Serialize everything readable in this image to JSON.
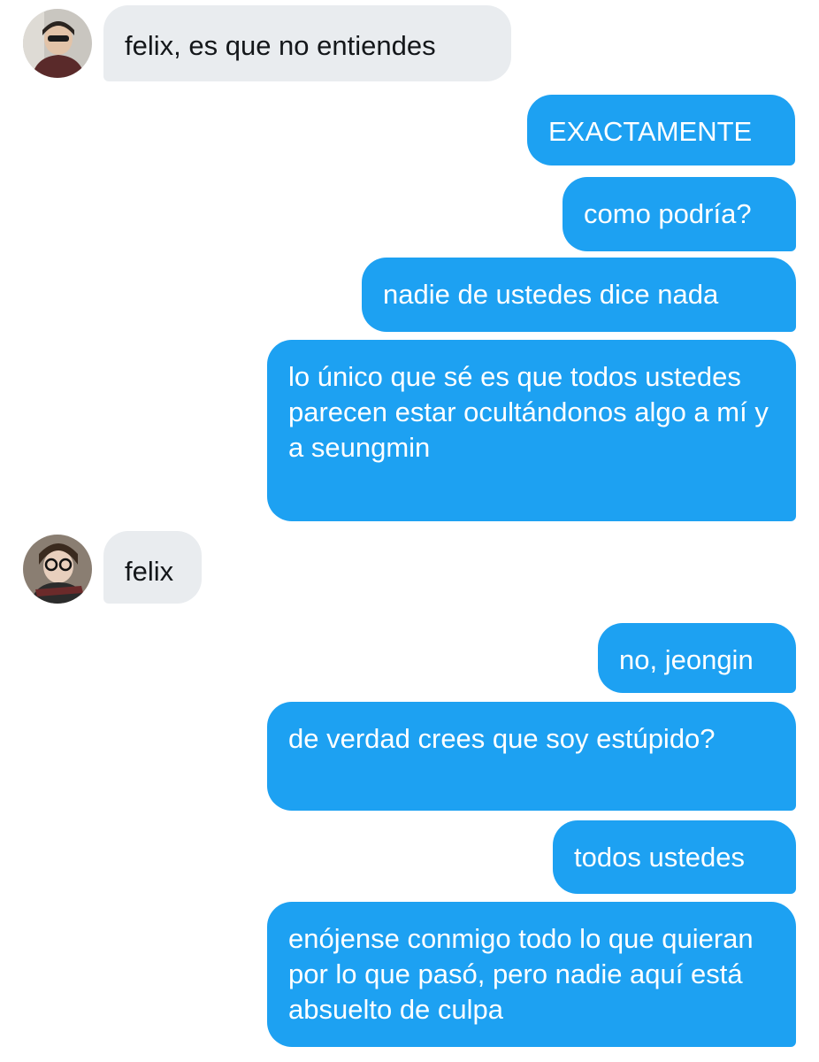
{
  "messages": [
    {
      "sender": "other",
      "text": "felix, es que no entiendes"
    },
    {
      "sender": "me",
      "text": "EXACTAMENTE"
    },
    {
      "sender": "me",
      "text": "como podría?"
    },
    {
      "sender": "me",
      "text": "nadie de ustedes dice nada"
    },
    {
      "sender": "me",
      "text": "lo único que sé es que todos ustedes parecen estar ocultándonos algo a mí y a seungmin"
    },
    {
      "sender": "other",
      "text": "felix"
    },
    {
      "sender": "me",
      "text": "no, jeongin"
    },
    {
      "sender": "me",
      "text": "de verdad crees que soy estúpido?"
    },
    {
      "sender": "me",
      "text": "todos ustedes"
    },
    {
      "sender": "me",
      "text": "enójense conmigo todo lo que quieran por lo que pasó, pero nadie aquí está absuelto de culpa"
    }
  ],
  "avatars": [
    {
      "icon": "user-avatar-photo"
    },
    {
      "icon": "user-avatar-photo"
    }
  ],
  "colors": {
    "sent_bubble": "#1da1f2",
    "received_bubble": "#e9ecef",
    "background": "#ffffff"
  }
}
